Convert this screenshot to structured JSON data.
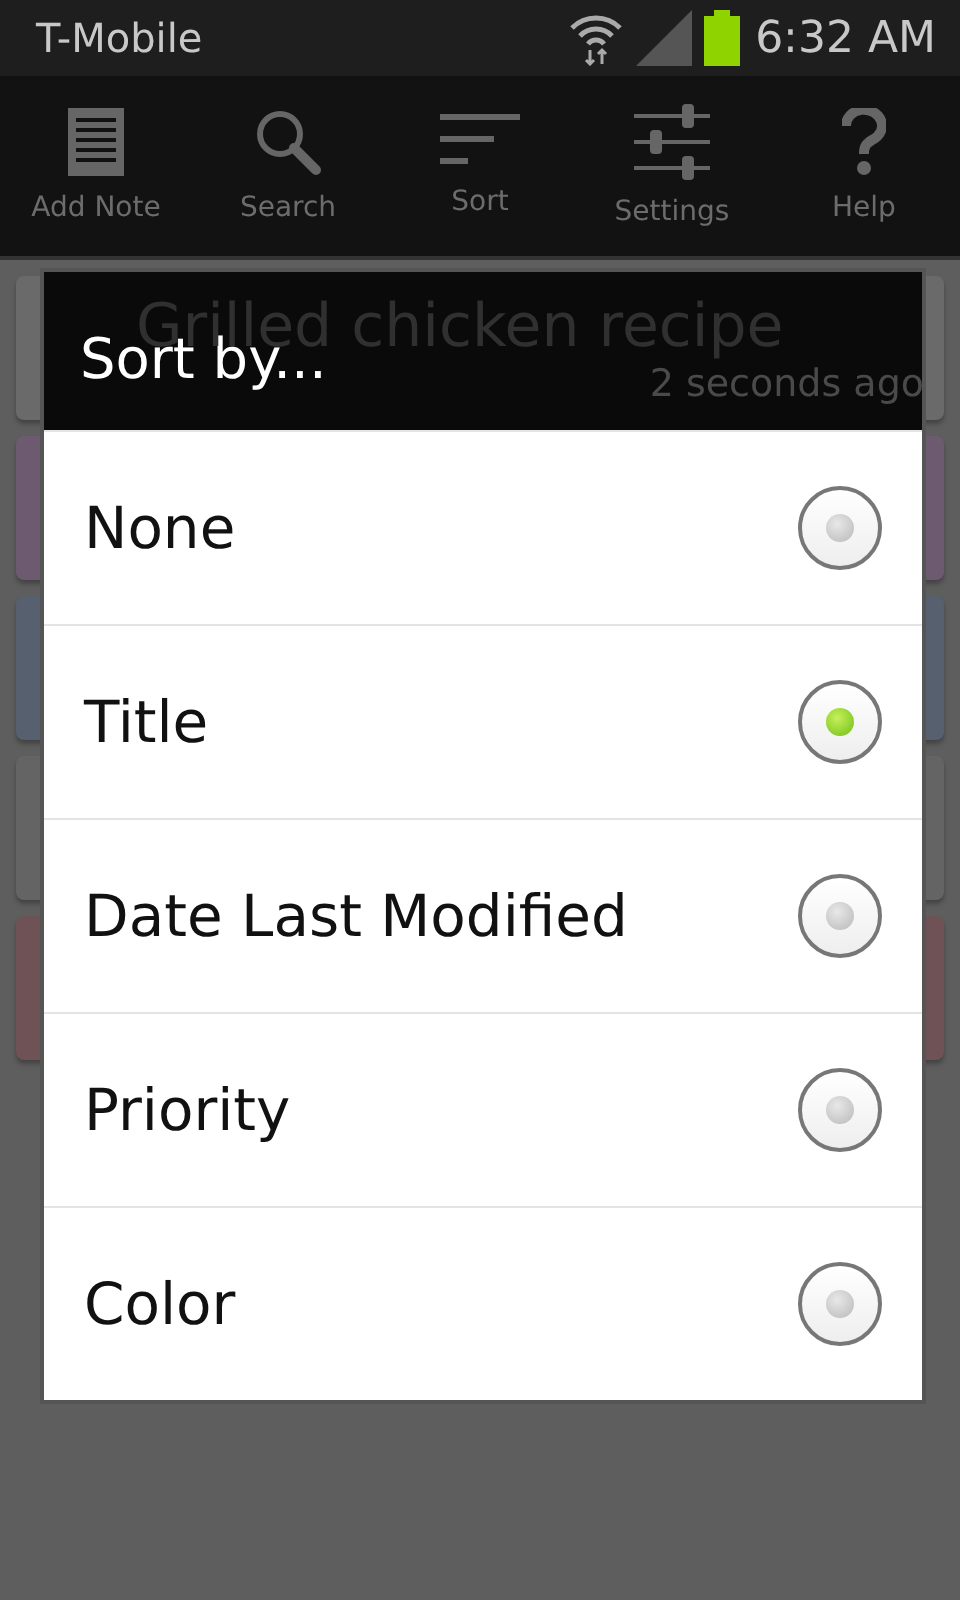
{
  "status_bar": {
    "carrier": "T-Mobile",
    "time": "6:32 AM"
  },
  "toolbar": [
    {
      "kind": "add",
      "label": "Add Note"
    },
    {
      "kind": "search",
      "label": "Search"
    },
    {
      "kind": "sort",
      "label": "Sort"
    },
    {
      "kind": "settings",
      "label": "Settings"
    },
    {
      "kind": "help",
      "label": "Help"
    }
  ],
  "notes": [
    {
      "title": "Grilled chicken recipe",
      "time": "2 seconds ago",
      "color": "#6a6a6a"
    },
    {
      "color": "#6e5a70"
    },
    {
      "color": "#56606e"
    },
    {
      "color": "#646464"
    },
    {
      "color": "#6e5256"
    }
  ],
  "dialog": {
    "title": "Sort by...",
    "options": [
      {
        "label": "None",
        "selected": false
      },
      {
        "label": "Title",
        "selected": true
      },
      {
        "label": "Date Last Modified",
        "selected": false
      },
      {
        "label": "Priority",
        "selected": false
      },
      {
        "label": "Color",
        "selected": false
      }
    ]
  }
}
